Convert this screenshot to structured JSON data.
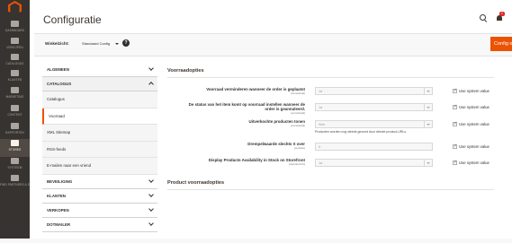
{
  "nav": {
    "items": [
      {
        "label": "DASHBOARD",
        "active": false
      },
      {
        "label": "VERKOPEN",
        "active": false
      },
      {
        "label": "CATALOGUS",
        "active": false
      },
      {
        "label": "KLANTEN",
        "active": false
      },
      {
        "label": "MARKETING",
        "active": false
      },
      {
        "label": "CONTENT",
        "active": false
      },
      {
        "label": "RAPPORTEN",
        "active": false
      },
      {
        "label": "STORES",
        "active": true
      },
      {
        "label": "SYSTEEM",
        "active": false
      },
      {
        "label": "FIND PARTNERS & EXTENSIONS",
        "active": false
      }
    ]
  },
  "header": {
    "title": "Configuratie",
    "notification_count": "1"
  },
  "scope": {
    "label": "Winkelzicht:",
    "value": "Standaard Config",
    "help": "?"
  },
  "save_button": "Config o",
  "tabs": {
    "algemeen": "ALGEMEEN",
    "catalogus": "CATALOGUS",
    "catalogus_items": [
      "Catalogus",
      "Voorraad",
      "XML Sitemap",
      "RSS-feeds",
      "E-mailen naar een vriend"
    ],
    "beveiliging": "BEVEILIGING",
    "klanten": "KLANTEN",
    "verkopen": "VERKOPEN",
    "dotmailer": "DOTMAILER"
  },
  "section": {
    "title": "Voorraadopties",
    "rows": [
      {
        "label": "Voorraad verminderen wanneer de order is geplaatst",
        "scope": "[wereldwijd]",
        "value": "Ja",
        "use_system": "Use system value",
        "checked": true
      },
      {
        "label": "De status van het item komt op voorraad instellen wanneer de order is geannuleerd.",
        "scope": "[wereldwijd]",
        "value": "Ja",
        "use_system": "Use system value",
        "checked": true
      },
      {
        "label": "Uitverkochte producten tonen",
        "scope": "[wereldwijd]",
        "value": "Nee",
        "use_system": "Use system value",
        "checked": true,
        "note": "Producten worden nog steeds gezond door directe product-URLs."
      },
      {
        "label": "Drempelwaarde slechts X over",
        "scope": "[website]",
        "value": "0",
        "use_system": "Use system value",
        "checked": true
      },
      {
        "label": "Display Products Availability in Stock on Storefront",
        "scope": "[websitezicht]",
        "value": "Ja",
        "use_system": "Use system value",
        "checked": true
      }
    ]
  },
  "section2": {
    "title": "Product voorraadopties"
  }
}
